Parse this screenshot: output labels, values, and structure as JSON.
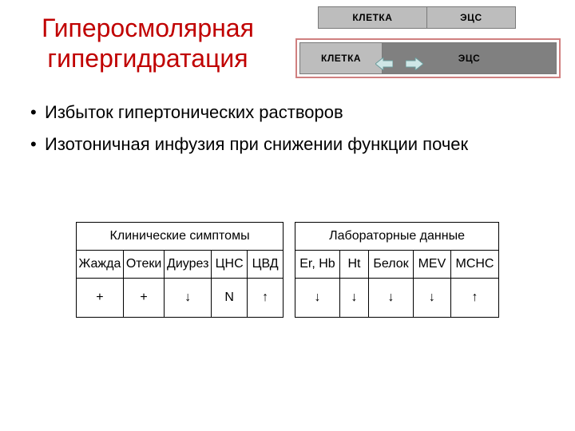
{
  "title": "Гиперосмолярная гипергидратация",
  "diagram": {
    "top_row": {
      "cell": "КЛЕТКА",
      "ecs": "ЭЦС"
    },
    "bottom_row": {
      "cell": "КЛЕТКА",
      "ecs": "ЭЦС"
    },
    "arrow_left_name": "arrow-left-icon",
    "arrow_right_name": "arrow-right-icon",
    "highlight_color": "#d08080"
  },
  "bullets": [
    "Избыток гипертонических растворов",
    "Изотоничная инфузия при снижении функции почек"
  ],
  "table": {
    "group_clinical": "Клинические симптомы",
    "group_lab": "Лабораторные данные",
    "clinical_headers": [
      "Жажда",
      "Отеки",
      "Диурез",
      "ЦНС",
      "ЦВД"
    ],
    "lab_headers": [
      "Er, Hb",
      "Ht",
      "Белок",
      "MEV",
      "MCHC"
    ],
    "clinical_values": [
      "+",
      "+",
      "↓",
      "N",
      "↑"
    ],
    "lab_values": [
      "↓",
      "↓",
      "↓",
      "↓",
      "↑"
    ]
  }
}
